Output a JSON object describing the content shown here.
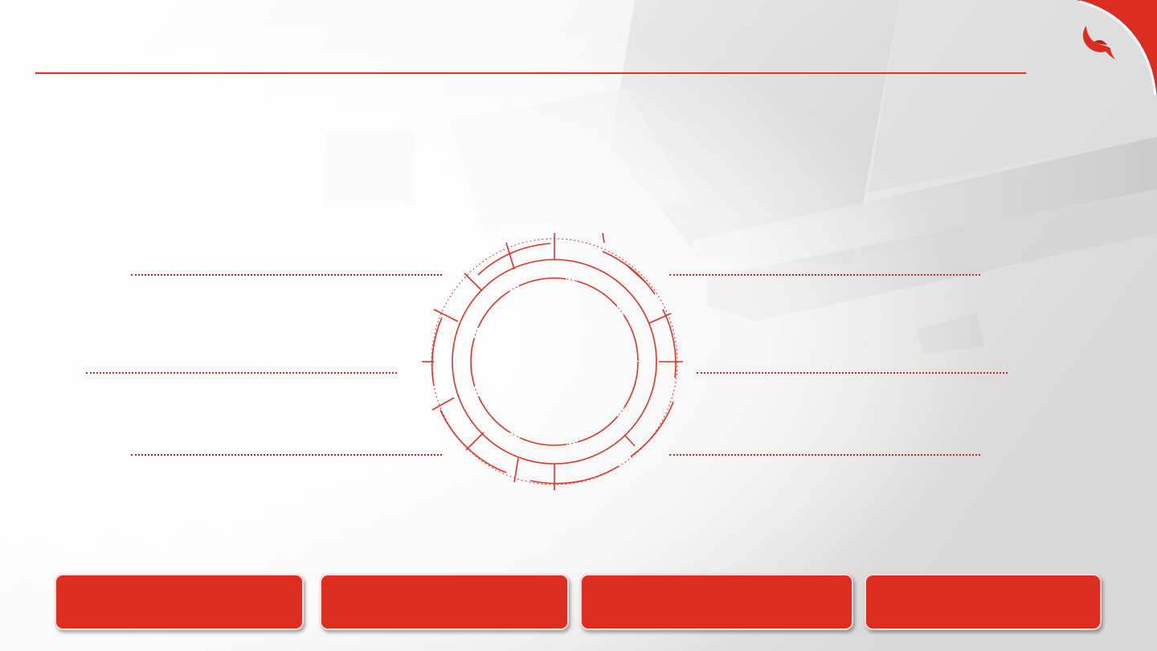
{
  "slide": {
    "title": "",
    "brand": {
      "logo_icon": "bird-logo-icon",
      "accent_color": "#dc2d20",
      "line_color": "#e0342a"
    },
    "diagram": {
      "ring_icon": "segmented-ring-diagram",
      "left_labels": [
        "",
        "",
        ""
      ],
      "right_labels": [
        "",
        "",
        ""
      ]
    },
    "footer_boxes": [
      {
        "label": ""
      },
      {
        "label": ""
      },
      {
        "label": ""
      },
      {
        "label": ""
      }
    ]
  }
}
